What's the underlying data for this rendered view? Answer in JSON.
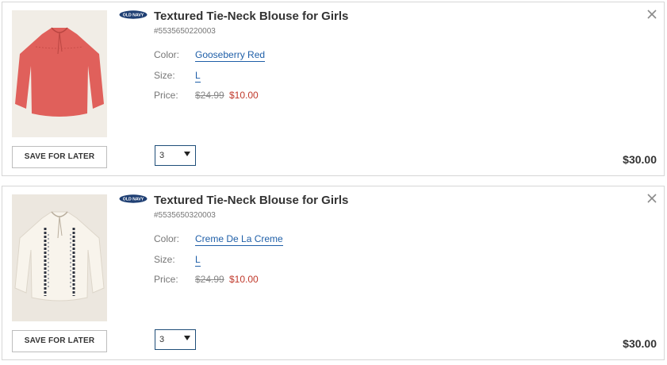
{
  "cart": {
    "items": [
      {
        "brand_logo_text": "OLD NAVY",
        "title": "Textured Tie-Neck Blouse for Girls",
        "sku": "#5535650220003",
        "color_label": "Color:",
        "color_value": "Gooseberry Red",
        "size_label": "Size:",
        "size_value": "L",
        "price_label": "Price:",
        "price_original": "$24.99",
        "price_sale": "$10.00",
        "quantity": "3",
        "total": "$30.00",
        "save_label": "SAVE FOR LATER",
        "image_color": "#e0605b"
      },
      {
        "brand_logo_text": "OLD NAVY",
        "title": "Textured Tie-Neck Blouse for Girls",
        "sku": "#5535650320003",
        "color_label": "Color:",
        "color_value": "Creme De La Creme",
        "size_label": "Size:",
        "size_value": "L",
        "price_label": "Price:",
        "price_original": "$24.99",
        "price_sale": "$10.00",
        "quantity": "3",
        "total": "$30.00",
        "save_label": "SAVE FOR LATER",
        "image_color": "#f4efe6"
      }
    ]
  },
  "colors": {
    "link": "#1f5fa8",
    "sale_price": "#c0392b",
    "brand_navy": "#1f3f73",
    "qty_border": "#1f4e79"
  },
  "icons": {
    "close": "close-icon",
    "dropdown": "chevron-down-icon",
    "brand": "old-navy-logo"
  }
}
